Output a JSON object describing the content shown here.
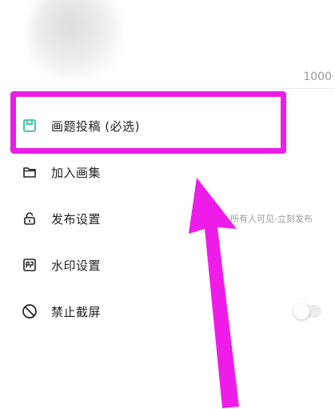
{
  "header": {
    "count_text": "1000"
  },
  "menu": [
    {
      "label": "画题投稿 (必选)",
      "icon": "draft-box-icon",
      "value": "",
      "icon_color": "#2ec4a0"
    },
    {
      "label": "加入画集",
      "icon": "folder-icon",
      "value": ""
    },
    {
      "label": "发布设置",
      "icon": "lock-icon",
      "value": "所有人可见-立刻发布"
    },
    {
      "label": "水印设置",
      "icon": "watermark-icon",
      "value": ""
    },
    {
      "label": "禁止截屏",
      "icon": "no-screenshot-icon",
      "value": "",
      "toggle_on": false
    }
  ],
  "colors": {
    "highlight": "#ee1ce8",
    "accent": "#2ec4a0"
  }
}
